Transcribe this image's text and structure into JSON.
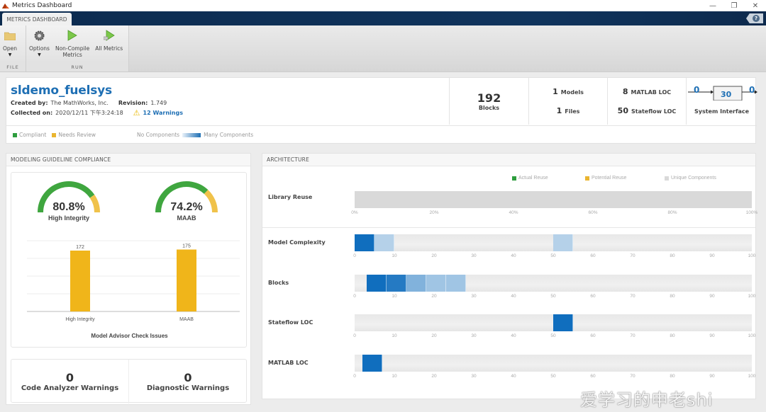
{
  "window": {
    "title": "Metrics Dashboard",
    "controls": [
      "minimize",
      "restore",
      "close"
    ]
  },
  "tabs": [
    {
      "label": "METRICS DASHBOARD",
      "active": true
    }
  ],
  "toolstrip": {
    "sections": [
      {
        "label": "FILE",
        "buttons": [
          {
            "label": "Open",
            "icon": "folder-icon",
            "has_dropdown": true
          }
        ]
      },
      {
        "label": "RUN",
        "buttons": [
          {
            "label": "Options",
            "icon": "gear-icon",
            "has_dropdown": true
          },
          {
            "label": "Non-Compile Metrics",
            "line1": "Non-Compile",
            "line2": "Metrics",
            "icon": "play-icon"
          },
          {
            "label": "All Metrics",
            "icon": "play-all-icon"
          }
        ]
      }
    ]
  },
  "summary": {
    "model_name": "sldemo_fuelsys",
    "created_by_label": "Created by:",
    "created_by": "The MathWorks, Inc.",
    "revision_label": "Revision:",
    "revision": "1.749",
    "collected_label": "Collected on:",
    "collected_on": "2020/12/11 下午3:24:18",
    "warnings": "12 Warnings",
    "blocks_value": "192",
    "blocks_label": "Blocks",
    "models_value": "1",
    "models_label": "Models",
    "files_value": "1",
    "files_label": "Files",
    "matlab_loc_value": "8",
    "matlab_loc_label": "MATLAB LOC",
    "stateflow_loc_value": "50",
    "stateflow_loc_label": "Stateflow LOC",
    "interface_in": "0",
    "interface_mid": "30",
    "interface_out": "0",
    "interface_label": "System Interface"
  },
  "legend": {
    "compliant": "Compliant",
    "needs_review": "Needs Review",
    "no_components": "No Components",
    "many_components": "Many Components"
  },
  "colors": {
    "compliant": "#3fa63f",
    "needs_review": "#f0b500",
    "accent": "#1e6fb4",
    "bar": "#f0b51a",
    "unique": "#d9d9d9"
  },
  "compliance": {
    "title": "MODELING GUIDELINE COMPLIANCE",
    "gauges": [
      {
        "name": "High Integrity",
        "value_label": "80.8%",
        "percent": 80.8
      },
      {
        "name": "MAAB",
        "value_label": "74.2%",
        "percent": 74.2
      }
    ],
    "chart_data": {
      "type": "bar",
      "title": "Model Advisor Check Issues",
      "categories": [
        "High Integrity",
        "MAAB"
      ],
      "values": [
        172,
        175
      ],
      "value_labels": [
        "172",
        "175"
      ],
      "ylim": [
        0,
        200
      ],
      "grid": true
    },
    "code_analyzer_value": "0",
    "code_analyzer_label": "Code Analyzer Warnings",
    "diagnostic_value": "0",
    "diagnostic_label": "Diagnostic Warnings"
  },
  "architecture": {
    "title": "ARCHITECTURE",
    "legend": [
      "Actual Reuse",
      "Potential Reuse",
      "Unique Components"
    ],
    "library_reuse": {
      "label": "Library Reuse",
      "unique_percent": 100,
      "ticks": [
        "0%",
        "20%",
        "40%",
        "60%",
        "80%",
        "100%"
      ]
    },
    "distributions": [
      {
        "label": "Model Complexity",
        "bins": [
          {
            "from": 0,
            "to": 5,
            "level": 1.0
          },
          {
            "from": 5,
            "to": 10,
            "level": 0.2
          },
          {
            "from": 50,
            "to": 55,
            "level": 0.2
          }
        ]
      },
      {
        "label": "Blocks",
        "bins": [
          {
            "from": 3,
            "to": 8,
            "level": 1.0
          },
          {
            "from": 8,
            "to": 13,
            "level": 0.9
          },
          {
            "from": 13,
            "to": 18,
            "level": 0.45
          },
          {
            "from": 18,
            "to": 23,
            "level": 0.3
          },
          {
            "from": 23,
            "to": 28,
            "level": 0.3
          }
        ]
      },
      {
        "label": "Stateflow LOC",
        "bins": [
          {
            "from": 50,
            "to": 55,
            "level": 1.0
          }
        ]
      },
      {
        "label": "MATLAB LOC",
        "bins": [
          {
            "from": 2,
            "to": 7,
            "level": 1.0
          }
        ]
      }
    ],
    "ticks": [
      "0",
      "10",
      "20",
      "30",
      "40",
      "50",
      "60",
      "70",
      "80",
      "90",
      "100"
    ]
  },
  "watermark": "爱学习的申老shi"
}
